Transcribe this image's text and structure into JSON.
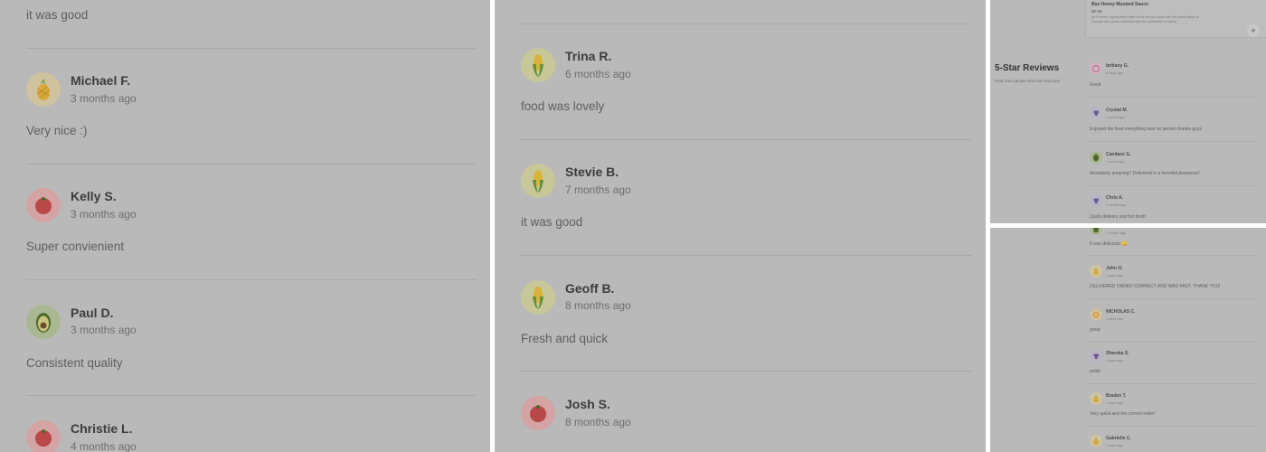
{
  "panel_a": {
    "top_text": "it was good",
    "reviews": [
      {
        "name": "Michael F.",
        "time": "3 months ago",
        "text": "Very nice :)",
        "icon": "pineapple-icon"
      },
      {
        "name": "Kelly S.",
        "time": "3 months ago",
        "text": "Super convienient",
        "icon": "tomato-icon"
      },
      {
        "name": "Paul D.",
        "time": "3 months ago",
        "text": "Consistent quality",
        "icon": "avocado-icon"
      },
      {
        "name": "Christie L.",
        "time": "4 months ago",
        "text": "",
        "icon": "tomato-icon"
      }
    ]
  },
  "panel_b": {
    "reviews": [
      {
        "name": "Trina R.",
        "time": "6 months ago",
        "text": "food was lovely",
        "icon": "corn-icon"
      },
      {
        "name": "Stevie B.",
        "time": "7 months ago",
        "text": "it was good",
        "icon": "corn-icon"
      },
      {
        "name": "Geoff B.",
        "time": "8 months ago",
        "text": "Fresh and quick",
        "icon": "corn-icon"
      },
      {
        "name": "Josh S.",
        "time": "8 months ago",
        "text": "",
        "icon": "tomato-icon"
      }
    ]
  },
  "panel_c": {
    "card": {
      "title": "Boz Honey Mustard Sauce",
      "price": "$2.99",
      "desc": "An 8 ounce, squeezable bottle of the savory sauce with the robust flavor of mustard and spices combined with the sweetness of honey.",
      "add": "+"
    },
    "section_title": "5-Star Reviews",
    "section_sub": "Hear from people who love this spot",
    "reviews": [
      {
        "name": "brittany G.",
        "time": "6 days ago",
        "text": "Great",
        "icon": "onion-icon"
      },
      {
        "name": "Crystal M.",
        "time": "1 week ago",
        "text": "Enjoyed the food everything was on perfect thanks guys",
        "icon": "grapes-icon"
      },
      {
        "name": "Candace G.",
        "time": "1 week ago",
        "text": "Absolutely amazing!! Delivered in a freestial downpour!",
        "icon": "avocado-icon"
      },
      {
        "name": "Chris A.",
        "time": "2 weeks ago",
        "text": "Quick delivery and hot food!",
        "icon": "grapes-icon"
      }
    ]
  },
  "panel_d": {
    "partial": {
      "time": "1 month ago",
      "text": "It was delicious 😋",
      "icon": "avocado-icon"
    },
    "reviews": [
      {
        "name": "John H.",
        "time": "1 year ago",
        "text": "DELIVERED ORDER CORRECT AND WAS FAST. THANK YOU!",
        "icon": "pineapple-icon"
      },
      {
        "name": "NICHOLAS C.",
        "time": "1 year ago",
        "text": "great",
        "icon": "orange-icon"
      },
      {
        "name": "Shareka S.",
        "time": "1 year ago",
        "text": "polite",
        "icon": "grapes-icon"
      },
      {
        "name": "Braden T.",
        "time": "1 year ago",
        "text": "Very quick and the correct order!",
        "icon": "pineapple-icon"
      },
      {
        "name": "Gabrielle C.",
        "time": "1 year ago",
        "text": "",
        "icon": "pineapple-icon"
      }
    ]
  }
}
